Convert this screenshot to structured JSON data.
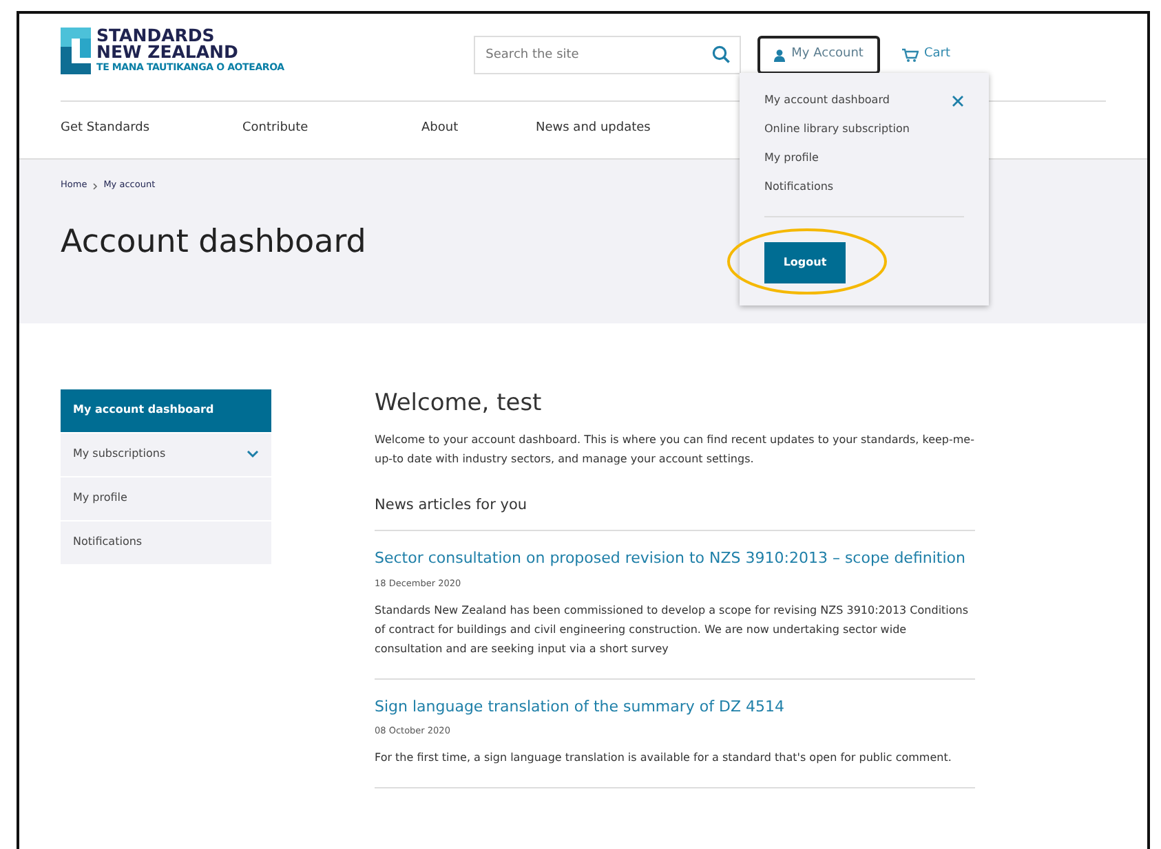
{
  "logo": {
    "line_1": "STANDARDS",
    "line_2": "NEW ZEALAND",
    "tagline": "TE MANA TAUTIKANGA O AOTEAROA"
  },
  "search": {
    "placeholder": "Search the site"
  },
  "account_button": {
    "label": "My Account"
  },
  "cart": {
    "label": "Cart"
  },
  "nav": [
    "Get Standards",
    "Contribute",
    "About",
    "News and updates"
  ],
  "account_menu": {
    "expanded": true,
    "items": [
      "My account dashboard",
      "Online library subscription",
      "My profile",
      "Notifications"
    ],
    "logout": "Logout",
    "logout_highlighted": true
  },
  "breadcrumb": [
    "Home",
    "My account"
  ],
  "page_title": "Account dashboard",
  "sidebar": {
    "items": [
      {
        "label": "My account dashboard",
        "selected": true,
        "expandable": false
      },
      {
        "label": "My subscriptions",
        "selected": false,
        "expandable": true
      },
      {
        "label": "My profile",
        "selected": false,
        "expandable": false
      },
      {
        "label": "Notifications",
        "selected": false,
        "expandable": false
      }
    ]
  },
  "welcome": {
    "heading": "Welcome, test",
    "text": "Welcome to your account dashboard. This is where you can find recent updates to your standards, keep-me-up-to date with industry sectors, and manage your account settings."
  },
  "news": {
    "heading": "News articles for you",
    "articles": [
      {
        "title": "Sector consultation on proposed revision to NZS 3910:2013 – scope definition",
        "date": "18 December 2020",
        "summary": "Standards New Zealand has been commissioned to develop a scope for revising NZS 3910:2013 Conditions of contract for buildings and civil engineering construction. We are now undertaking sector wide consultation and are seeking input via a short survey"
      },
      {
        "title": "Sign language translation of the summary of DZ 4514",
        "date": "08 October 2020",
        "summary": "For the first time, a sign language translation is available for a standard that's open for public comment."
      }
    ]
  }
}
